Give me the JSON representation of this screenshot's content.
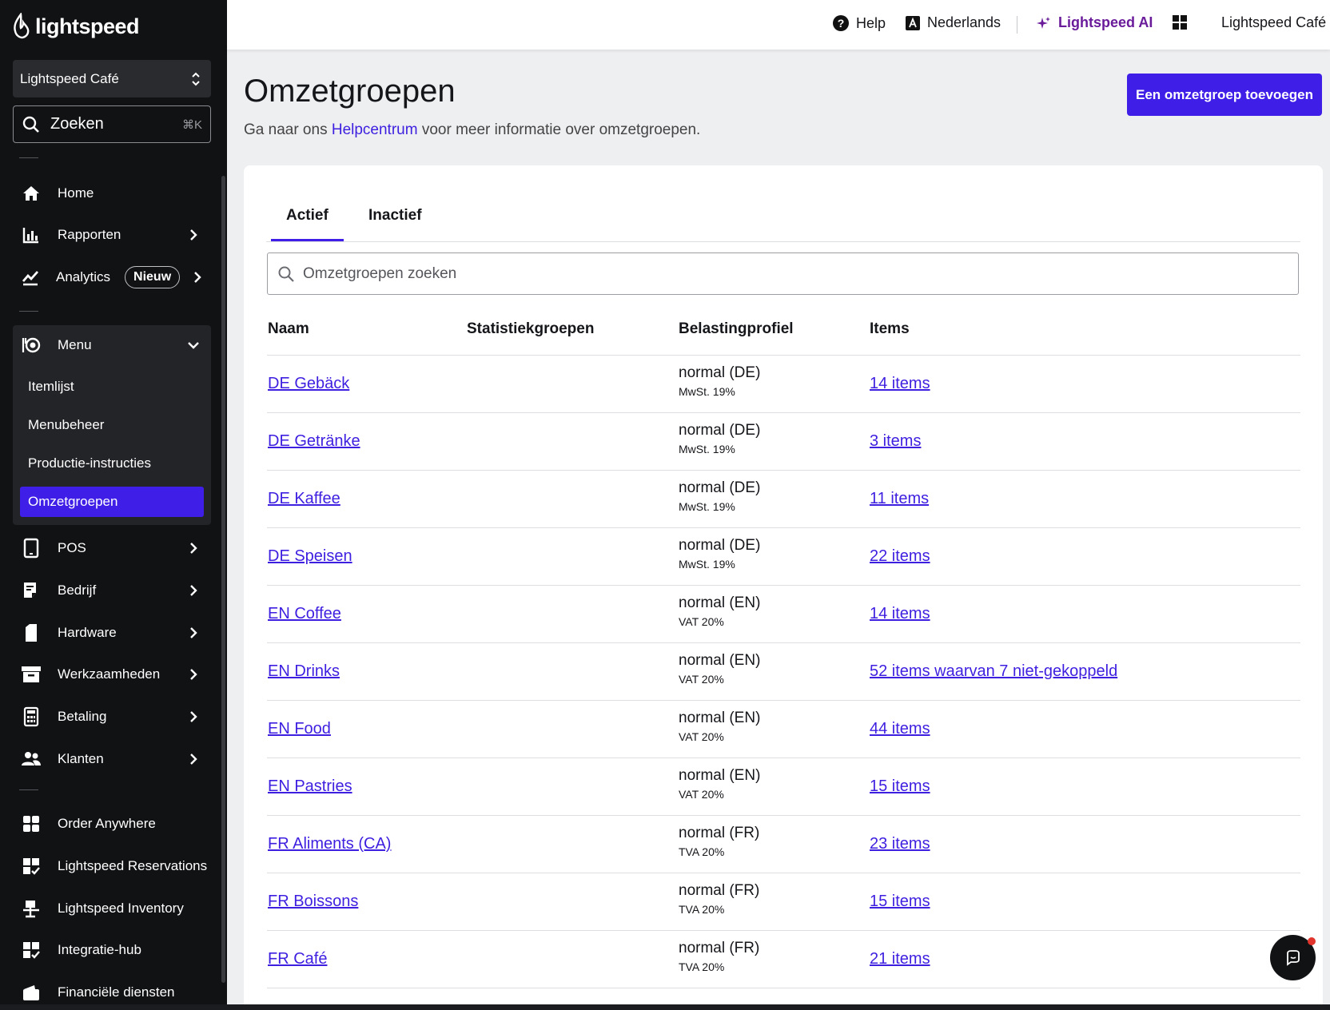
{
  "brand": {
    "logo_text": "lightspeed"
  },
  "sidebar": {
    "store_name": "Lightspeed Café",
    "search_label": "Zoeken",
    "search_shortcut": "⌘K",
    "items": [
      {
        "label": "Home",
        "icon": "home-icon"
      },
      {
        "label": "Rapporten",
        "icon": "bar-chart-icon"
      },
      {
        "label": "Analytics",
        "icon": "trend-line-icon",
        "badge": "Nieuw"
      },
      {
        "label": "Menu",
        "icon": "menu-dish-icon"
      },
      {
        "label": "POS",
        "icon": "tablet-icon"
      },
      {
        "label": "Bedrijf",
        "icon": "receipt-icon"
      },
      {
        "label": "Hardware",
        "icon": "device-icon"
      },
      {
        "label": "Werkzaamheden",
        "icon": "archive-icon"
      },
      {
        "label": "Betaling",
        "icon": "calculator-icon"
      },
      {
        "label": "Klanten",
        "icon": "people-icon"
      },
      {
        "label": "Order Anywhere",
        "icon": "grid-icon"
      },
      {
        "label": "Lightspeed Reservations",
        "icon": "grid-check-icon"
      },
      {
        "label": "Lightspeed Inventory",
        "icon": "inventory-icon"
      },
      {
        "label": "Integratie-hub",
        "icon": "grid-check-icon"
      },
      {
        "label": "Financiële diensten",
        "icon": "wallet-icon"
      }
    ],
    "menu_subitems": [
      "Itemlijst",
      "Menubeheer",
      "Productie-instructies",
      "Omzetgroepen"
    ],
    "active_subitem": "Omzetgroepen"
  },
  "topbar": {
    "help": "Help",
    "language": "Nederlands",
    "ai": "Lightspeed AI",
    "account": "Lightspeed Café",
    "ai_color": "#6a1b9a"
  },
  "page": {
    "title": "Omzetgroepen",
    "sub_prefix": "Ga naar ons ",
    "sub_link": "Helpcentrum",
    "sub_suffix": " voor meer informatie over omzetgroepen.",
    "add_button": "Een omzetgroep toevoegen"
  },
  "tabs": [
    "Actief",
    "Inactief"
  ],
  "table": {
    "search_placeholder": "Omzetgroepen zoeken",
    "headers": [
      "Naam",
      "Statistiekgroepen",
      "Belastingprofiel",
      "Items"
    ],
    "rows": [
      {
        "name": "DE Gebäck",
        "tax": "normal (DE)",
        "rate": "MwSt. 19%",
        "items": "14 items"
      },
      {
        "name": "DE Getränke",
        "tax": "normal (DE)",
        "rate": "MwSt. 19%",
        "items": "3 items"
      },
      {
        "name": "DE Kaffee",
        "tax": "normal (DE)",
        "rate": "MwSt. 19%",
        "items": "11 items"
      },
      {
        "name": "DE Speisen",
        "tax": "normal (DE)",
        "rate": "MwSt. 19%",
        "items": "22 items"
      },
      {
        "name": "EN Coffee",
        "tax": "normal (EN)",
        "rate": "VAT 20%",
        "items": "14 items"
      },
      {
        "name": "EN Drinks",
        "tax": "normal (EN)",
        "rate": "VAT 20%",
        "items": "52 items waarvan 7 niet-gekoppeld"
      },
      {
        "name": "EN Food",
        "tax": "normal (EN)",
        "rate": "VAT 20%",
        "items": "44 items"
      },
      {
        "name": "EN Pastries",
        "tax": "normal (EN)",
        "rate": "VAT 20%",
        "items": "15 items"
      },
      {
        "name": "FR Aliments (CA)",
        "tax": "normal (FR)",
        "rate": "TVA 20%",
        "items": "23 items"
      },
      {
        "name": "FR Boissons",
        "tax": "normal (FR)",
        "rate": "TVA 20%",
        "items": "15 items"
      },
      {
        "name": "FR Café",
        "tax": "normal (FR)",
        "rate": "TVA 20%",
        "items": "21 items"
      }
    ]
  },
  "colors": {
    "accent": "#3f1ee8",
    "link": "#3d1fe0",
    "sidebar_bg": "#111214"
  }
}
